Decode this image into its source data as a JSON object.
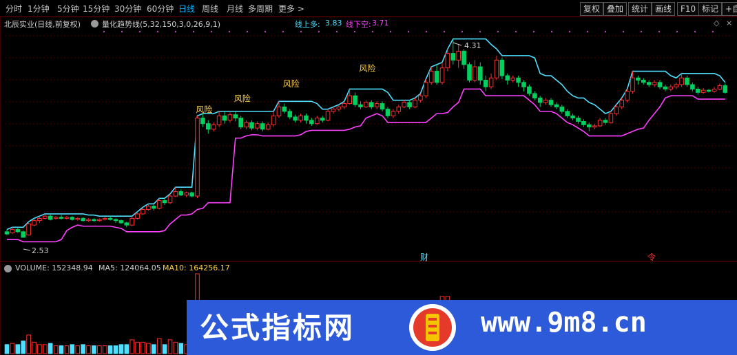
{
  "toolbar": {
    "timeframes": [
      "分时",
      "1分钟",
      "5分钟",
      "15分钟",
      "30分钟",
      "60分钟",
      "日线",
      "周线",
      "月线",
      "多周期",
      "更多 >"
    ],
    "active_timeframe": "日线",
    "buttons": [
      "复权",
      "叠加",
      "统计",
      "画线",
      "F10",
      "标记",
      "+自"
    ]
  },
  "header": {
    "stock": "北辰实业(日线,前复权)",
    "indicator": "量化趋势线(5,32,150,3,0,26,9,1)",
    "line_up_label": "线上多:",
    "line_up_value": "3.83",
    "line_down_label": "线下空:",
    "line_down_value": "3.71"
  },
  "price_labels": {
    "high": "4.31",
    "low": "2.53"
  },
  "risk_label": "风险",
  "markers": {
    "finance": "财",
    "other": "令"
  },
  "volume_header": {
    "volume": "VOLUME: 152348.94",
    "ma5": "MA5: 124064.05",
    "ma10": "MA10: 164256.17"
  },
  "watermark": {
    "title": "公式指标网",
    "url": "www.9m8.cn"
  },
  "colors": {
    "up": "#ff3030",
    "down": "#00d060",
    "cyan": "#50e0ff",
    "magenta": "#ff40ff",
    "active": "#00b4ff",
    "risk": "#ffd24a",
    "watermark_bg": "#2d5ad8"
  },
  "chart_data": {
    "type": "candlestick",
    "ylim": [
      2.4,
      4.4
    ],
    "high_label": 4.31,
    "low_label": 2.53,
    "candles": [
      [
        2.58,
        2.56,
        2.6,
        2.55
      ],
      [
        2.57,
        2.6,
        2.62,
        2.56
      ],
      [
        2.6,
        2.58,
        2.62,
        2.57
      ],
      [
        2.58,
        2.53,
        2.59,
        2.53
      ],
      [
        2.55,
        2.65,
        2.67,
        2.55
      ],
      [
        2.64,
        2.68,
        2.7,
        2.63
      ],
      [
        2.68,
        2.7,
        2.72,
        2.66
      ],
      [
        2.7,
        2.72,
        2.74,
        2.69
      ],
      [
        2.72,
        2.69,
        2.74,
        2.68
      ],
      [
        2.7,
        2.71,
        2.72,
        2.69
      ],
      [
        2.71,
        2.7,
        2.73,
        2.69
      ],
      [
        2.7,
        2.71,
        2.72,
        2.69
      ],
      [
        2.71,
        2.69,
        2.72,
        2.68
      ],
      [
        2.69,
        2.7,
        2.71,
        2.68
      ],
      [
        2.7,
        2.68,
        2.71,
        2.67
      ],
      [
        2.68,
        2.69,
        2.7,
        2.67
      ],
      [
        2.69,
        2.68,
        2.7,
        2.67
      ],
      [
        2.68,
        2.69,
        2.7,
        2.67
      ],
      [
        2.69,
        2.7,
        2.71,
        2.68
      ],
      [
        2.7,
        2.69,
        2.72,
        2.68
      ],
      [
        2.69,
        2.68,
        2.7,
        2.66
      ],
      [
        2.68,
        2.66,
        2.69,
        2.65
      ],
      [
        2.66,
        2.64,
        2.67,
        2.62
      ],
      [
        2.64,
        2.7,
        2.72,
        2.63
      ],
      [
        2.7,
        2.74,
        2.76,
        2.69
      ],
      [
        2.74,
        2.78,
        2.8,
        2.73
      ],
      [
        2.78,
        2.81,
        2.83,
        2.77
      ],
      [
        2.81,
        2.79,
        2.83,
        2.77
      ],
      [
        2.79,
        2.86,
        2.88,
        2.78
      ],
      [
        2.86,
        2.84,
        2.88,
        2.82
      ],
      [
        2.84,
        2.9,
        2.92,
        2.83
      ],
      [
        2.9,
        2.94,
        2.98,
        2.89
      ],
      [
        2.94,
        2.91,
        2.96,
        2.9
      ],
      [
        2.91,
        2.93,
        2.94,
        2.89
      ],
      [
        2.93,
        2.9,
        2.94,
        2.89
      ],
      [
        2.9,
        3.6,
        3.62,
        2.88
      ],
      [
        3.6,
        3.55,
        3.64,
        3.52
      ],
      [
        3.55,
        3.5,
        3.58,
        3.46
      ],
      [
        3.5,
        3.54,
        3.56,
        3.48
      ],
      [
        3.54,
        3.62,
        3.66,
        3.52
      ],
      [
        3.62,
        3.58,
        3.66,
        3.55
      ],
      [
        3.58,
        3.63,
        3.65,
        3.56
      ],
      [
        3.63,
        3.6,
        3.66,
        3.57
      ],
      [
        3.6,
        3.52,
        3.62,
        3.5
      ],
      [
        3.52,
        3.56,
        3.58,
        3.5
      ],
      [
        3.56,
        3.51,
        3.58,
        3.49
      ],
      [
        3.51,
        3.55,
        3.57,
        3.49
      ],
      [
        3.55,
        3.5,
        3.57,
        3.48
      ],
      [
        3.5,
        3.54,
        3.56,
        3.49
      ],
      [
        3.54,
        3.62,
        3.66,
        3.52
      ],
      [
        3.62,
        3.7,
        3.75,
        3.6
      ],
      [
        3.7,
        3.66,
        3.73,
        3.64
      ],
      [
        3.66,
        3.61,
        3.68,
        3.59
      ],
      [
        3.61,
        3.58,
        3.63,
        3.56
      ],
      [
        3.58,
        3.62,
        3.64,
        3.56
      ],
      [
        3.62,
        3.58,
        3.64,
        3.55
      ],
      [
        3.58,
        3.55,
        3.6,
        3.53
      ],
      [
        3.55,
        3.6,
        3.62,
        3.54
      ],
      [
        3.6,
        3.58,
        3.62,
        3.56
      ],
      [
        3.58,
        3.66,
        3.68,
        3.57
      ],
      [
        3.66,
        3.68,
        3.7,
        3.64
      ],
      [
        3.68,
        3.7,
        3.72,
        3.66
      ],
      [
        3.7,
        3.73,
        3.75,
        3.68
      ],
      [
        3.73,
        3.8,
        3.86,
        3.72
      ],
      [
        3.8,
        3.72,
        3.83,
        3.7
      ],
      [
        3.72,
        3.7,
        3.75,
        3.68
      ],
      [
        3.7,
        3.74,
        3.76,
        3.69
      ],
      [
        3.74,
        3.7,
        3.76,
        3.68
      ],
      [
        3.7,
        3.73,
        3.75,
        3.68
      ],
      [
        3.73,
        3.68,
        3.75,
        3.66
      ],
      [
        3.68,
        3.62,
        3.7,
        3.6
      ],
      [
        3.62,
        3.66,
        3.68,
        3.6
      ],
      [
        3.66,
        3.7,
        3.72,
        3.64
      ],
      [
        3.7,
        3.74,
        3.76,
        3.69
      ],
      [
        3.74,
        3.7,
        3.76,
        3.68
      ],
      [
        3.7,
        3.76,
        3.78,
        3.69
      ],
      [
        3.76,
        3.8,
        3.82,
        3.74
      ],
      [
        3.8,
        3.92,
        3.95,
        3.78
      ],
      [
        3.92,
        4.02,
        4.06,
        3.9
      ],
      [
        4.02,
        3.92,
        4.08,
        3.9
      ],
      [
        3.92,
        4.05,
        4.1,
        3.9
      ],
      [
        4.05,
        4.18,
        4.22,
        4.02
      ],
      [
        4.18,
        4.12,
        4.31,
        4.08
      ],
      [
        4.12,
        4.2,
        4.26,
        4.05
      ],
      [
        4.2,
        4.08,
        4.22,
        4.04
      ],
      [
        4.08,
        3.94,
        4.1,
        3.92
      ],
      [
        3.94,
        4.06,
        4.12,
        3.92
      ],
      [
        4.06,
        3.94,
        4.1,
        3.9
      ],
      [
        3.94,
        3.88,
        3.98,
        3.84
      ],
      [
        3.88,
        3.96,
        4.0,
        3.86
      ],
      [
        3.96,
        4.12,
        4.16,
        3.94
      ],
      [
        4.12,
        3.98,
        4.14,
        3.95
      ],
      [
        3.98,
        3.94,
        4.0,
        3.9
      ],
      [
        3.94,
        3.96,
        3.98,
        3.92
      ],
      [
        3.96,
        3.92,
        3.98,
        3.88
      ],
      [
        3.92,
        3.88,
        3.94,
        3.84
      ],
      [
        3.88,
        3.82,
        3.9,
        3.8
      ],
      [
        3.82,
        3.78,
        3.84,
        3.76
      ],
      [
        3.78,
        3.74,
        3.8,
        3.7
      ],
      [
        3.74,
        3.76,
        3.78,
        3.72
      ],
      [
        3.76,
        3.72,
        3.78,
        3.7
      ],
      [
        3.72,
        3.7,
        3.74,
        3.68
      ],
      [
        3.7,
        3.66,
        3.72,
        3.64
      ],
      [
        3.66,
        3.62,
        3.68,
        3.6
      ],
      [
        3.62,
        3.6,
        3.64,
        3.58
      ],
      [
        3.6,
        3.57,
        3.62,
        3.55
      ],
      [
        3.57,
        3.54,
        3.59,
        3.52
      ],
      [
        3.54,
        3.52,
        3.56,
        3.48
      ],
      [
        3.52,
        3.53,
        3.55,
        3.5
      ],
      [
        3.53,
        3.58,
        3.6,
        3.52
      ],
      [
        3.58,
        3.56,
        3.6,
        3.54
      ],
      [
        3.56,
        3.64,
        3.66,
        3.55
      ],
      [
        3.64,
        3.7,
        3.72,
        3.62
      ],
      [
        3.7,
        3.76,
        3.78,
        3.68
      ],
      [
        3.76,
        3.84,
        3.86,
        3.74
      ],
      [
        3.84,
        3.96,
        4.02,
        3.82
      ],
      [
        3.96,
        3.94,
        3.98,
        3.9
      ],
      [
        3.94,
        3.92,
        3.96,
        3.9
      ],
      [
        3.92,
        3.9,
        3.94,
        3.88
      ],
      [
        3.9,
        3.92,
        3.94,
        3.88
      ],
      [
        3.92,
        3.88,
        3.94,
        3.86
      ],
      [
        3.88,
        3.86,
        3.9,
        3.84
      ],
      [
        3.86,
        3.88,
        3.9,
        3.84
      ],
      [
        3.88,
        3.9,
        3.92,
        3.86
      ],
      [
        3.9,
        3.96,
        4.0,
        3.88
      ],
      [
        3.96,
        3.9,
        3.98,
        3.88
      ],
      [
        3.9,
        3.86,
        3.92,
        3.84
      ],
      [
        3.86,
        3.83,
        3.88,
        3.81
      ],
      [
        3.83,
        3.85,
        3.87,
        3.82
      ],
      [
        3.85,
        3.84,
        3.86,
        3.83
      ],
      [
        3.84,
        3.86,
        3.88,
        3.83
      ],
      [
        3.86,
        3.89,
        3.91,
        3.85
      ],
      [
        3.89,
        3.83,
        3.91,
        3.82
      ]
    ],
    "volume_ylim": [
      0,
      120
    ]
  }
}
